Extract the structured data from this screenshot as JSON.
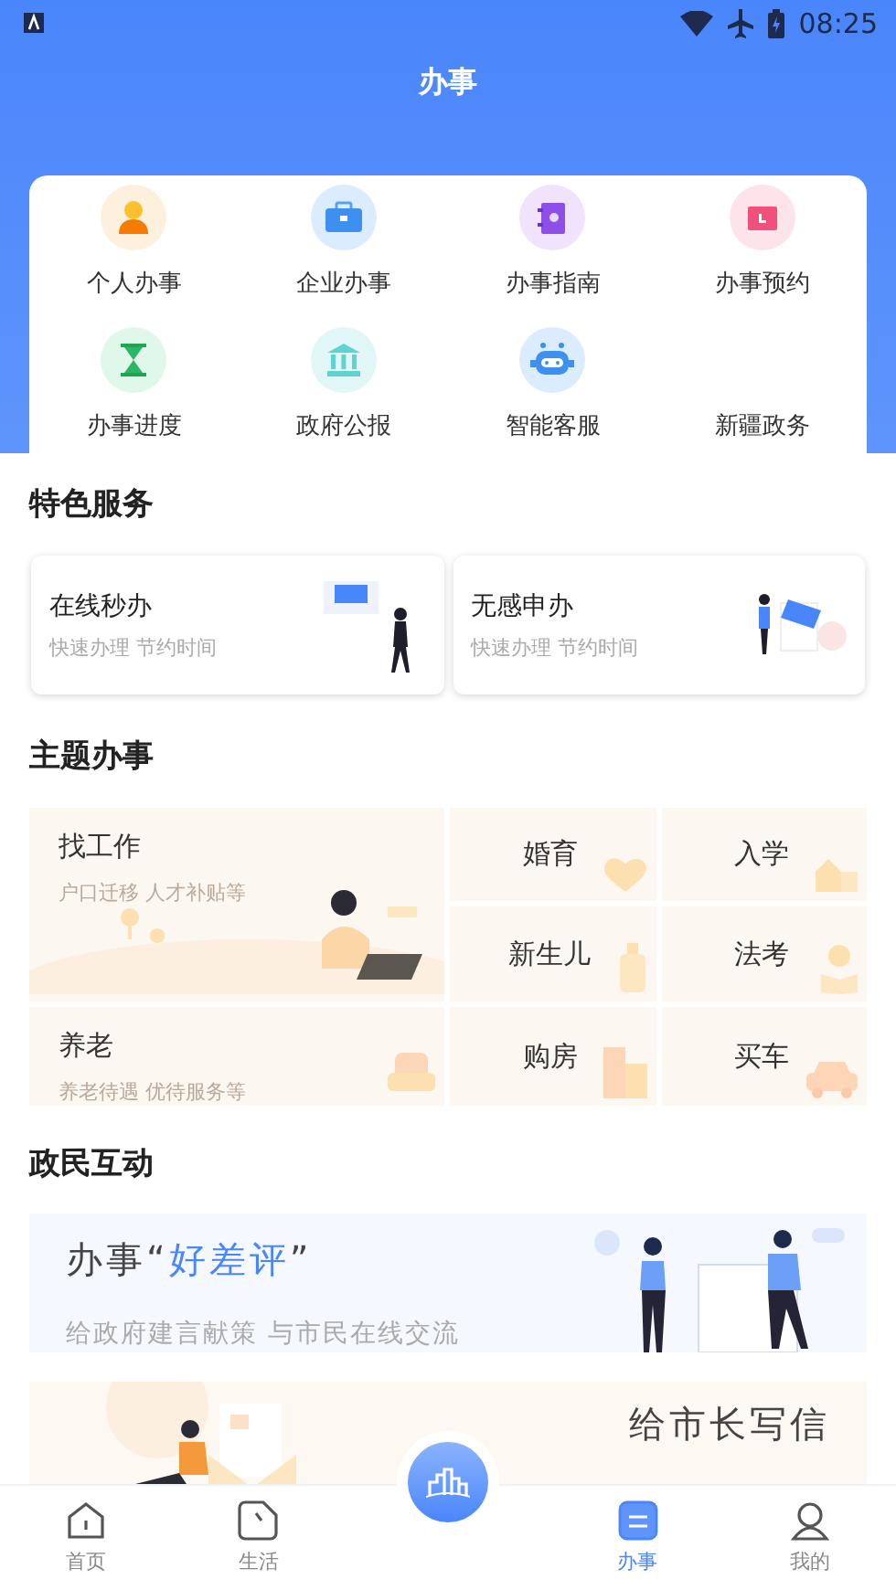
{
  "status_bar": {
    "time": "08:25"
  },
  "header": {
    "title": "办事"
  },
  "services": [
    {
      "label": "个人办事",
      "color": "#fdf0dc"
    },
    {
      "label": "企业办事",
      "color": "#dcecff"
    },
    {
      "label": "办事指南",
      "color": "#f1e3fd"
    },
    {
      "label": "办事预约",
      "color": "#fde3ea"
    },
    {
      "label": "办事进度",
      "color": "#e0f8ea"
    },
    {
      "label": "政府公报",
      "color": "#e0f6f7"
    },
    {
      "label": "智能客服",
      "color": "#dcecff"
    },
    {
      "label": "新疆政务"
    }
  ],
  "featured": {
    "title": "特色服务",
    "cards": [
      {
        "title": "在线秒办",
        "subtitle": "快速办理 节约时间"
      },
      {
        "title": "无感申办",
        "subtitle": "快速办理 节约时间"
      }
    ]
  },
  "topics": {
    "title": "主题办事",
    "large": [
      {
        "title": "找工作",
        "subtitle": "户口迁移 人才补贴等"
      },
      {
        "title": "养老",
        "subtitle": "养老待遇 优待服务等"
      }
    ],
    "small": [
      {
        "title": "婚育"
      },
      {
        "title": "入学"
      },
      {
        "title": "新生儿"
      },
      {
        "title": "法考"
      },
      {
        "title": "购房"
      },
      {
        "title": "买车"
      }
    ]
  },
  "interaction": {
    "title": "政民互动",
    "banners": [
      {
        "title": "办事“**好差评**”",
        "subtitle": "给政府建言献策 与市民在线交流"
      },
      {
        "title": "给市长写信"
      }
    ]
  },
  "tab_bar": [
    {
      "label": "首页",
      "selected": false
    },
    {
      "label": "生活",
      "selected": false
    },
    {
      "label": "办事",
      "selected": true
    },
    {
      "label": "我的",
      "selected": false
    }
  ]
}
